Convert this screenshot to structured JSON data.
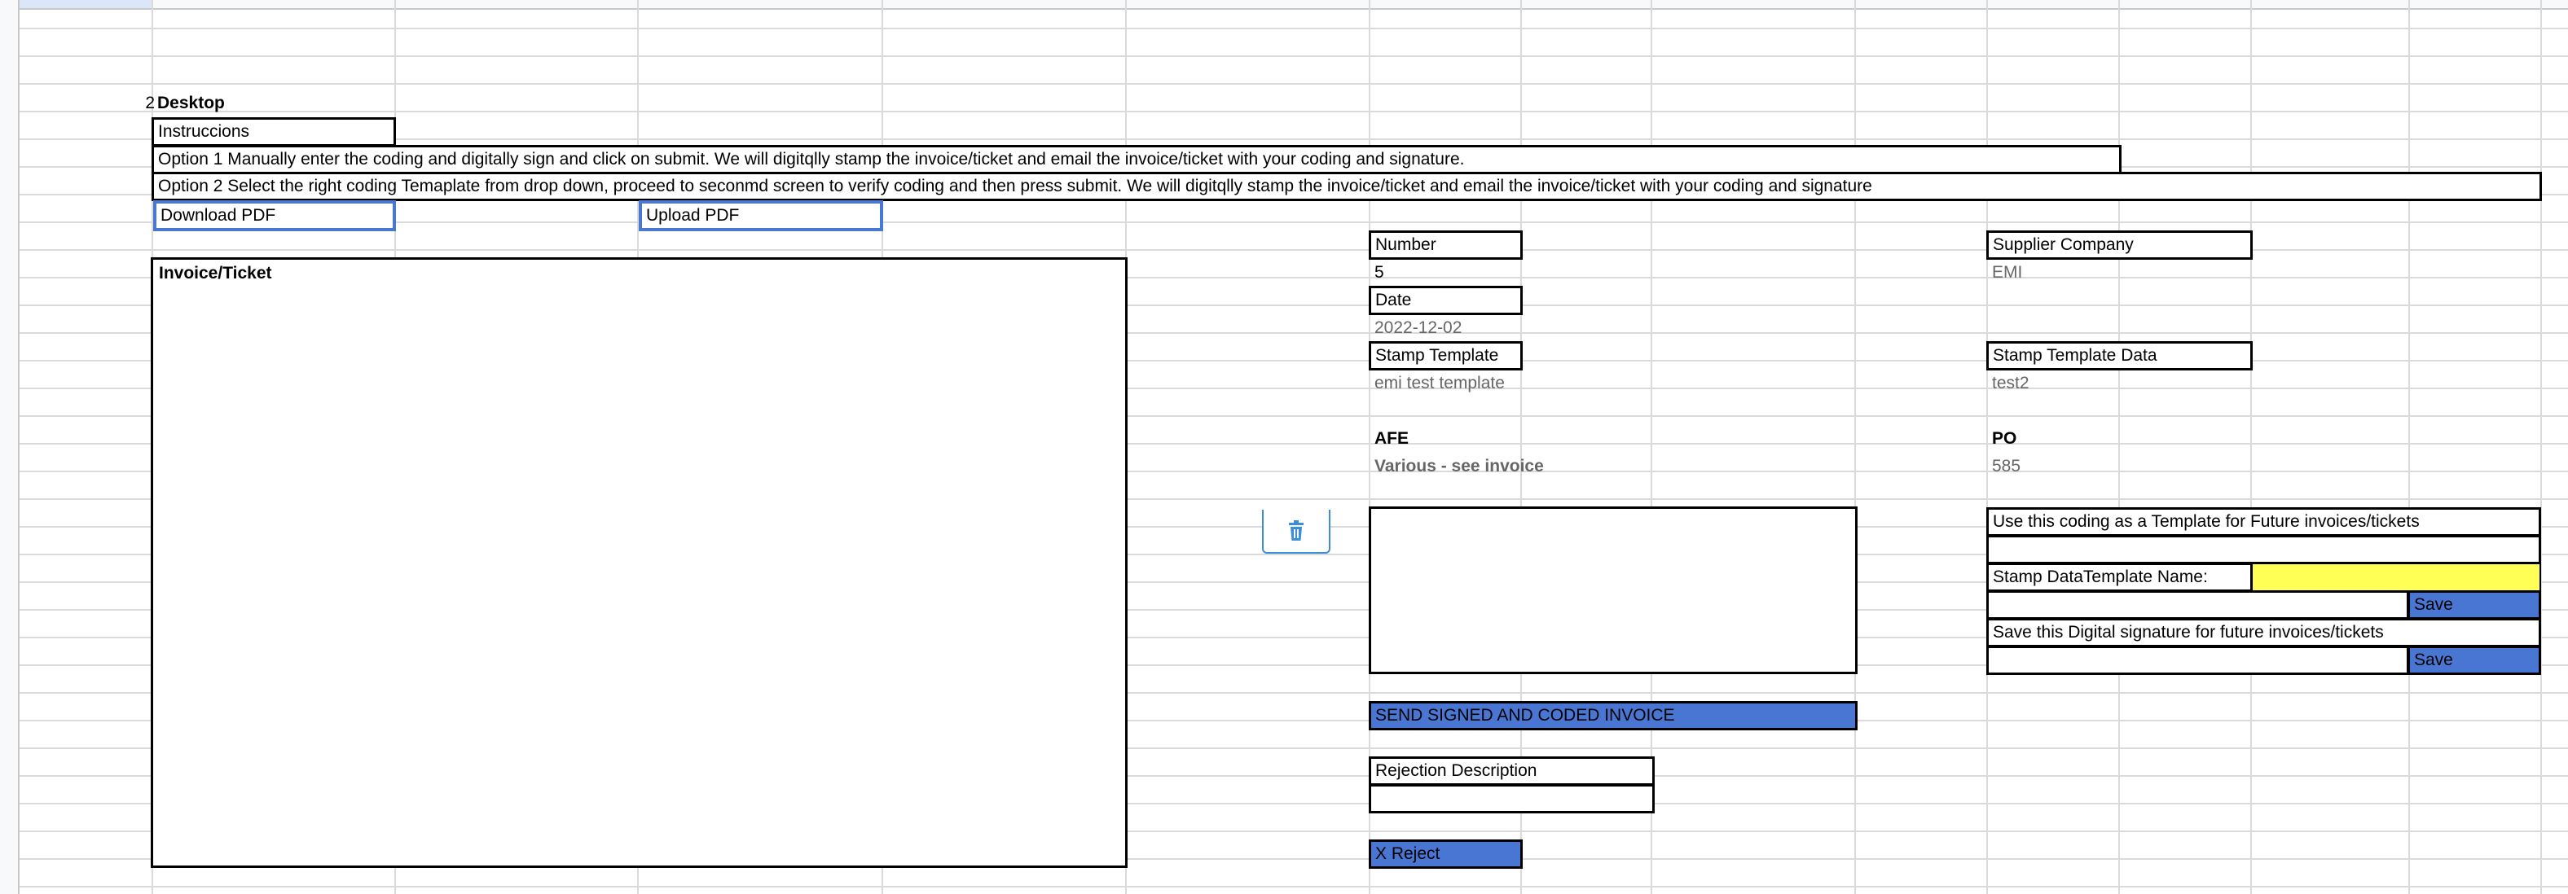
{
  "sheet": {
    "row_number": "2",
    "section_title": "Desktop"
  },
  "instructions": {
    "heading": "Instruccions",
    "option1": "Option 1 Manually enter the coding and digitally sign and click on submit. We will digitqlly stamp the invoice/ticket and email the invoice/ticket with your coding and signature.",
    "option2": "Option 2 Select the right coding Temaplate from drop down, proceed to seconmd screen to verify coding and then press submit. We will digitqlly stamp the invoice/ticket and email the invoice/ticket with your coding and signature"
  },
  "buttons": {
    "download_pdf": "Download PDF",
    "upload_pdf": "Upload PDF",
    "send_signed": "SEND SIGNED AND CODED INVOICE",
    "reject": "X Reject",
    "save_template": "Save",
    "save_signature": "Save"
  },
  "invoice_panel": {
    "title": "Invoice/Ticket"
  },
  "fields": {
    "number_label": "Number",
    "number_value": "5",
    "date_label": "Date",
    "date_value": "2022-12-02",
    "stamp_template_label": "Stamp Template",
    "stamp_template_value": "emi test template",
    "afe_label": "AFE",
    "afe_value": "Various - see invoice",
    "supplier_label": "Supplier Company",
    "supplier_value": "EMI",
    "stamp_template_data_label": "Stamp Template Data",
    "stamp_template_data_value": "test2",
    "po_label": "PO",
    "po_value": "585"
  },
  "template_options": {
    "use_coding_label": "Use this coding as a Template for Future invoices/tickets",
    "template_name_label": "Stamp DataTemplate Name:",
    "template_name_value": "",
    "save_signature_label": "Save this Digital signature for future invoices/tickets"
  },
  "rejection": {
    "label": "Rejection Description",
    "value": ""
  },
  "icons": {
    "delete": "trash-icon"
  },
  "colors": {
    "button_blue": "#4a76d3",
    "highlight_yellow": "#ffff55",
    "link_border_blue": "#4a78d0"
  }
}
